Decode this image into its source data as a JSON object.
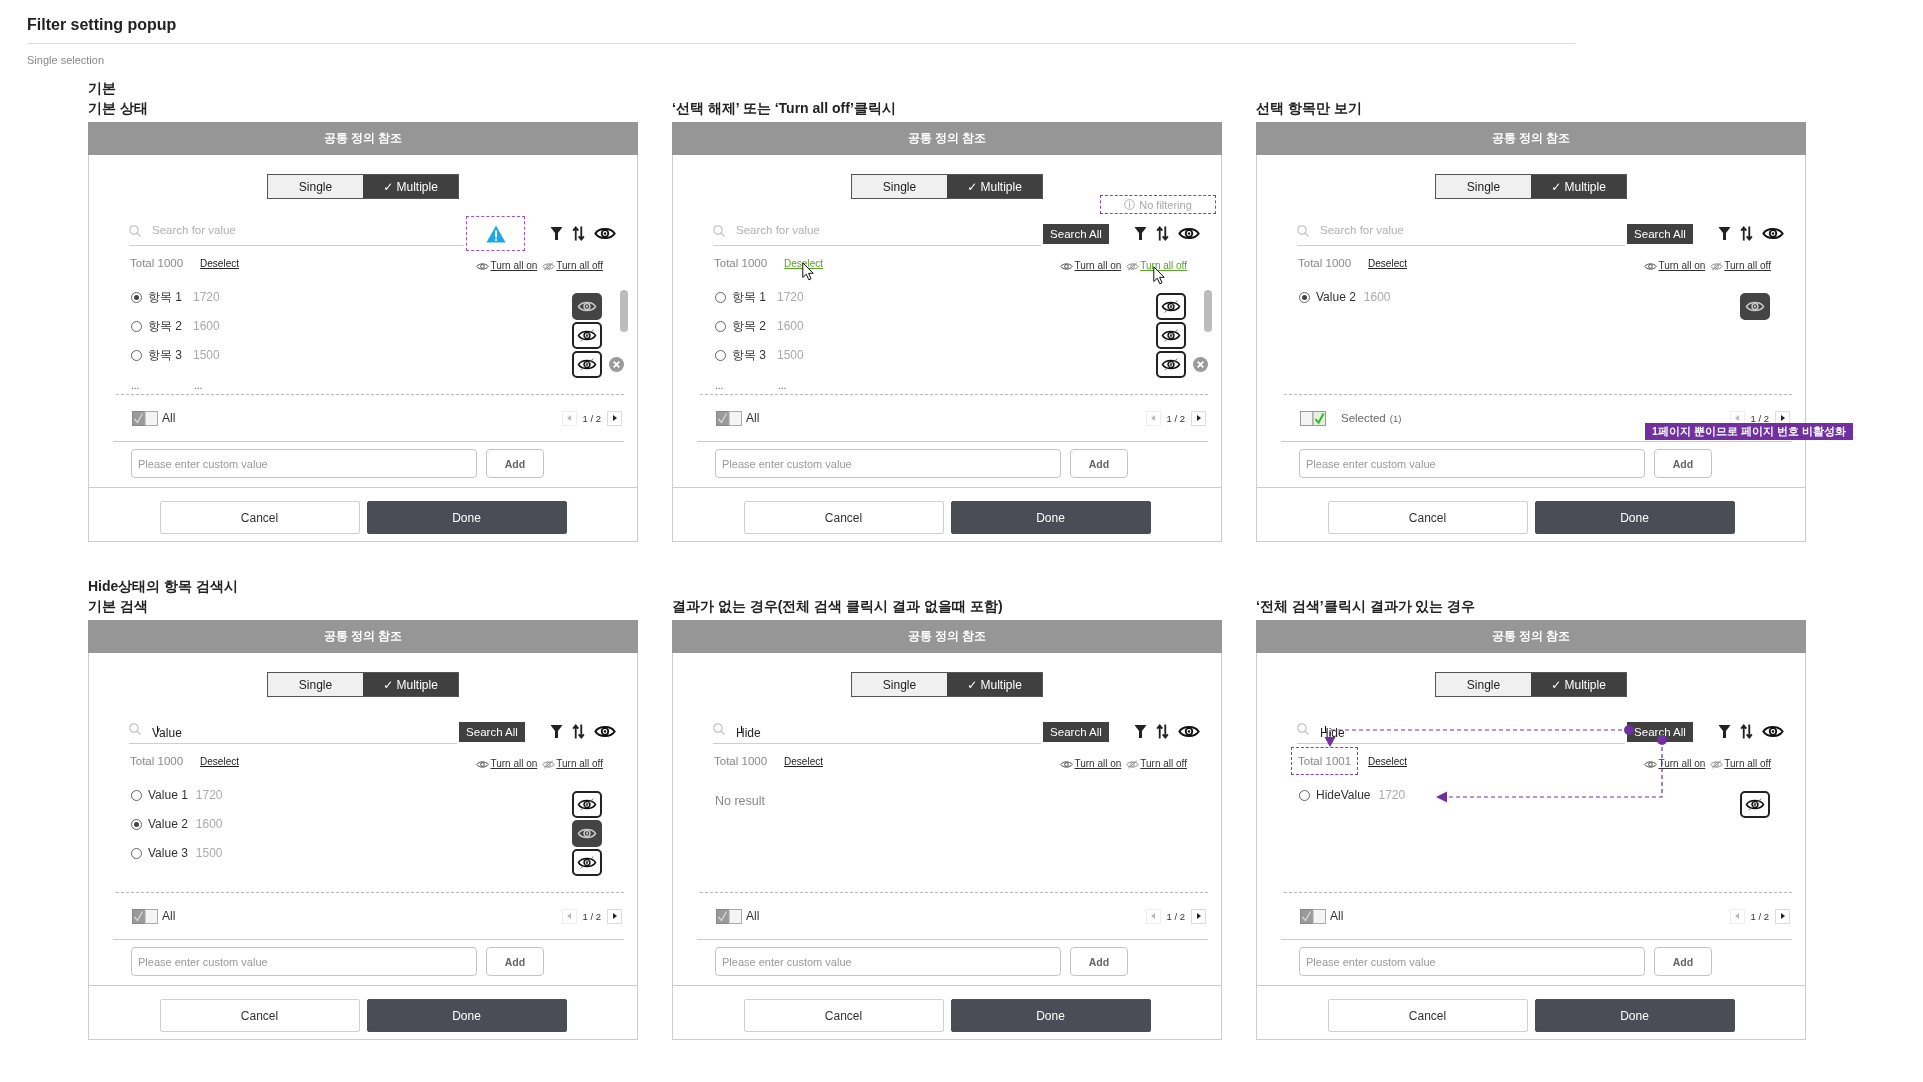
{
  "page": {
    "title": "Filter setting popup",
    "subtitle": "Single selection"
  },
  "panels": [
    {
      "headings": [
        "기본",
        "기본 상태"
      ],
      "header": "공통 정의 참조",
      "mode_tabs": [
        {
          "label": "Single",
          "selected": false
        },
        {
          "label": "✓ Multiple",
          "selected": true
        }
      ],
      "search": {
        "placeholder": "Search for value"
      },
      "search_action": {
        "kind": "warning"
      },
      "total": {
        "text": "Total 1000",
        "highlighted": false
      },
      "deselect": {
        "label": "Deselect",
        "clicked": false
      },
      "visibility_links": [
        {
          "label": "Turn all on",
          "kind": "on",
          "clicked": false
        },
        {
          "label": "Turn all off",
          "kind": "off",
          "clicked": false
        }
      ],
      "items": [
        {
          "label": "항목 1",
          "count": "1720",
          "selected": true,
          "hidden": false,
          "removable": false
        },
        {
          "label": "항목 2",
          "count": "1600",
          "selected": false,
          "hidden": true,
          "removable": false
        },
        {
          "label": "항목 3",
          "count": "1500",
          "selected": false,
          "hidden": true,
          "removable": true
        }
      ],
      "more": [
        "...",
        "..."
      ],
      "scrollable": true,
      "footer_toggle": {
        "label": "All",
        "on": false
      },
      "pagination": {
        "page": "1 / 2",
        "previous_disabled": true
      },
      "custom_value": {
        "placeholder": "Please enter custom value",
        "button": "Add"
      },
      "actions": [
        {
          "label": "Cancel",
          "kind": "secondary"
        },
        {
          "label": "Done",
          "kind": "primary"
        }
      ]
    },
    {
      "headings": [
        "‘선택 해제’ 또는 ‘Turn all off’클릭시"
      ],
      "header": "공통 정의 참조",
      "mode_tabs": [
        {
          "label": "Single",
          "selected": false
        },
        {
          "label": "✓ Multiple",
          "selected": true
        }
      ],
      "hint": "No filtering",
      "search": {
        "placeholder": "Search for value"
      },
      "search_action": {
        "kind": "search_all",
        "label": "Search All"
      },
      "total": {
        "text": "Total 1000",
        "highlighted": false
      },
      "deselect": {
        "label": "Deselect",
        "clicked": true
      },
      "visibility_links": [
        {
          "label": "Turn all on",
          "kind": "on",
          "clicked": false
        },
        {
          "label": "Turn all off",
          "kind": "off",
          "clicked": true
        }
      ],
      "items": [
        {
          "label": "항목 1",
          "count": "1720",
          "selected": false,
          "hidden": true,
          "removable": false
        },
        {
          "label": "항목 2",
          "count": "1600",
          "selected": false,
          "hidden": true,
          "removable": false
        },
        {
          "label": "항목 3",
          "count": "1500",
          "selected": false,
          "hidden": true,
          "removable": true
        }
      ],
      "more": [
        "...",
        "..."
      ],
      "scrollable": true,
      "footer_toggle": {
        "label": "All",
        "on": false
      },
      "pagination": {
        "page": "1 / 2",
        "previous_disabled": true
      },
      "custom_value": {
        "placeholder": "Please enter custom value",
        "button": "Add"
      },
      "actions": [
        {
          "label": "Cancel",
          "kind": "secondary"
        },
        {
          "label": "Done",
          "kind": "primary"
        }
      ]
    },
    {
      "headings": [
        "선택 항목만 보기"
      ],
      "header": "공통 정의 참조",
      "mode_tabs": [
        {
          "label": "Single",
          "selected": false
        },
        {
          "label": "✓ Multiple",
          "selected": true
        }
      ],
      "search": {
        "placeholder": "Search for value"
      },
      "search_action": {
        "kind": "search_all",
        "label": "Search All"
      },
      "total": {
        "text": "Total 1000",
        "highlighted": false
      },
      "deselect": {
        "label": "Deselect",
        "clicked": false
      },
      "visibility_links": [
        {
          "label": "Turn all on",
          "kind": "on",
          "clicked": false
        },
        {
          "label": "Turn all off",
          "kind": "off",
          "clicked": false
        }
      ],
      "items": [
        {
          "label": "Value 2",
          "count": "1600",
          "selected": true,
          "hidden": false,
          "removable": false
        }
      ],
      "scrollable": false,
      "footer_toggle": {
        "label": "Selected",
        "count": "(1)",
        "on": true
      },
      "pagination": {
        "page": "1 / 2",
        "previous_disabled": true
      },
      "note": "1페이지 뿐이므로 페이지 번호 비활성화",
      "custom_value": {
        "placeholder": "Please enter custom value",
        "button": "Add"
      },
      "actions": [
        {
          "label": "Cancel",
          "kind": "secondary"
        },
        {
          "label": "Done",
          "kind": "primary"
        }
      ]
    },
    {
      "headings": [
        "Hide상태의 항목 검색시",
        "기본 검색"
      ],
      "header": "공통 정의 참조",
      "mode_tabs": [
        {
          "label": "Single",
          "selected": false
        },
        {
          "label": "✓ Multiple",
          "selected": true
        }
      ],
      "search": {
        "value": "Value",
        "focused": true
      },
      "search_action": {
        "kind": "search_all",
        "label": "Search All"
      },
      "total": {
        "text": "Total 1000",
        "highlighted": false
      },
      "deselect": {
        "label": "Deselect",
        "clicked": false
      },
      "visibility_links": [
        {
          "label": "Turn all on",
          "kind": "on",
          "clicked": false
        },
        {
          "label": "Turn all off",
          "kind": "off",
          "clicked": false
        }
      ],
      "items": [
        {
          "label": "Value 1",
          "count": "1720",
          "selected": false,
          "hidden": true,
          "removable": false
        },
        {
          "label": "Value 2",
          "count": "1600",
          "selected": true,
          "hidden": false,
          "removable": false
        },
        {
          "label": "Value 3",
          "count": "1500",
          "selected": false,
          "hidden": true,
          "removable": false
        }
      ],
      "scrollable": false,
      "footer_toggle": {
        "label": "All",
        "on": false
      },
      "pagination": {
        "page": "1 / 2",
        "previous_disabled": true
      },
      "custom_value": {
        "placeholder": "Please enter custom value",
        "button": "Add"
      },
      "actions": [
        {
          "label": "Cancel",
          "kind": "secondary"
        },
        {
          "label": "Done",
          "kind": "primary"
        }
      ]
    },
    {
      "headings": [
        "결과가 없는 경우(전체 검색 클릭시 결과 없을때 포함)"
      ],
      "header": "공통 정의 참조",
      "mode_tabs": [
        {
          "label": "Single",
          "selected": false
        },
        {
          "label": "✓ Multiple",
          "selected": true
        }
      ],
      "search": {
        "value": "Hide",
        "focused": true
      },
      "search_action": {
        "kind": "search_all",
        "label": "Search All"
      },
      "total": {
        "text": "Total 1000",
        "highlighted": false
      },
      "deselect": {
        "label": "Deselect",
        "clicked": false
      },
      "visibility_links": [
        {
          "label": "Turn all on",
          "kind": "on",
          "clicked": false
        },
        {
          "label": "Turn all off",
          "kind": "off",
          "clicked": false
        }
      ],
      "empty_message": "No result",
      "scrollable": false,
      "footer_toggle": {
        "label": "All",
        "on": false
      },
      "pagination": {
        "page": "1 / 2",
        "previous_disabled": true
      },
      "custom_value": {
        "placeholder": "Please enter custom value",
        "button": "Add"
      },
      "actions": [
        {
          "label": "Cancel",
          "kind": "secondary"
        },
        {
          "label": "Done",
          "kind": "primary"
        }
      ]
    },
    {
      "headings": [
        "‘전체 검색’클릭시 결과가 있는 경우"
      ],
      "header": "공통 정의 참조",
      "mode_tabs": [
        {
          "label": "Single",
          "selected": false
        },
        {
          "label": "✓ Multiple",
          "selected": true
        }
      ],
      "search": {
        "value": "Hide",
        "focused": true
      },
      "search_action": {
        "kind": "search_all",
        "label": "Search All"
      },
      "total": {
        "text": "Total 1001",
        "highlighted": true
      },
      "deselect": {
        "label": "Deselect",
        "clicked": false
      },
      "visibility_links": [
        {
          "label": "Turn all on",
          "kind": "on",
          "clicked": false
        },
        {
          "label": "Turn all off",
          "kind": "off",
          "clicked": false
        }
      ],
      "items": [
        {
          "label": "HideValue",
          "count": "1720",
          "selected": false,
          "hidden": true,
          "removable": false
        }
      ],
      "scrollable": false,
      "flow_arrows": true,
      "footer_toggle": {
        "label": "All",
        "on": false
      },
      "pagination": {
        "page": "1 / 2",
        "previous_disabled": true
      },
      "custom_value": {
        "placeholder": "Please enter custom value",
        "button": "Add"
      },
      "actions": [
        {
          "label": "Cancel",
          "kind": "secondary"
        },
        {
          "label": "Done",
          "kind": "primary"
        }
      ]
    }
  ]
}
